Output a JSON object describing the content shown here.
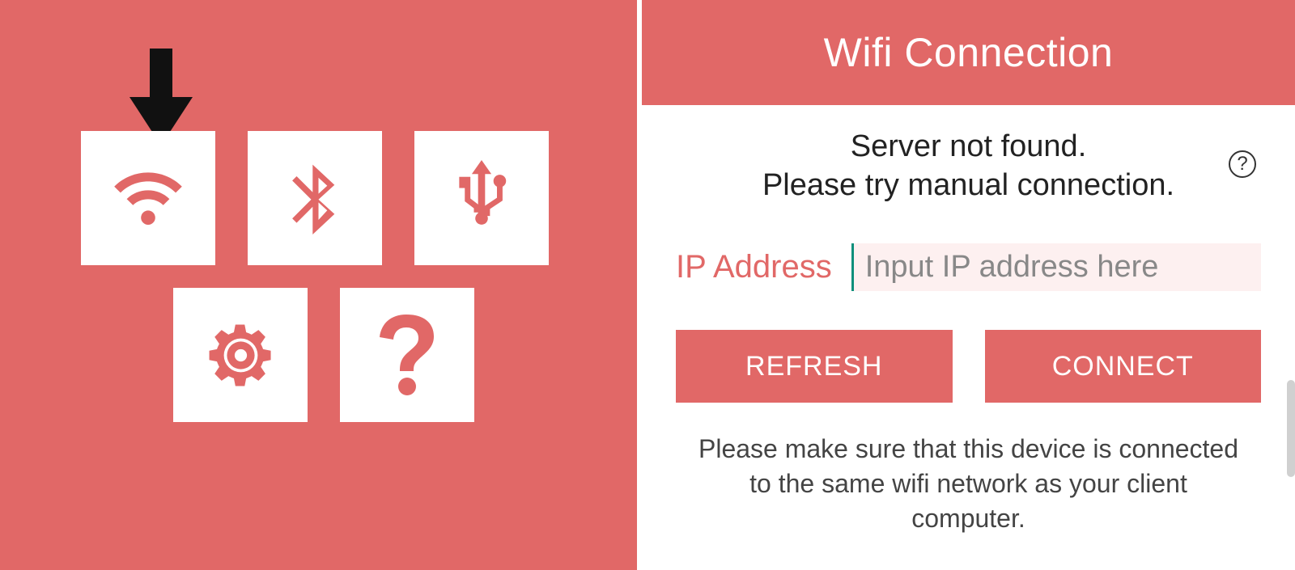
{
  "left": {
    "tiles": {
      "wifi": {
        "icon": "wifi-icon"
      },
      "bluetooth": {
        "icon": "bluetooth-icon"
      },
      "usb": {
        "icon": "usb-icon"
      },
      "settings": {
        "icon": "gear-icon"
      },
      "help": {
        "icon": "question-icon"
      }
    }
  },
  "right": {
    "title": "Wifi Connection",
    "status_line1": "Server not found.",
    "status_line2": "Please try manual connection.",
    "help_glyph": "?",
    "ip_label": "IP Address",
    "ip_placeholder": "Input IP address here",
    "ip_value": "",
    "refresh_label": "REFRESH",
    "connect_label": "CONNECT",
    "footnote": "Please make sure that this device is connected to the same wifi network as your client computer."
  }
}
